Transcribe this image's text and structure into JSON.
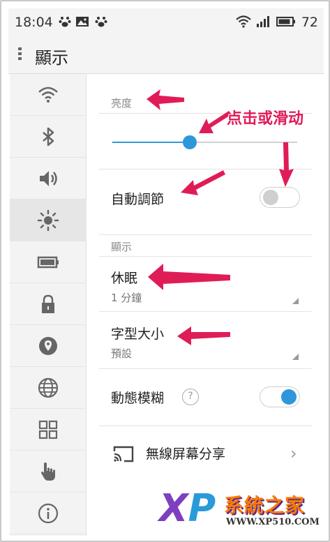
{
  "status_bar": {
    "time": "18:04",
    "battery_level": "72",
    "icons": [
      "paw-icon",
      "image-icon",
      "paw-icon",
      "wifi-icon",
      "signal-icon",
      "battery-icon"
    ]
  },
  "title_bar": {
    "title": "顯示"
  },
  "sidebar": {
    "items": [
      {
        "icon": "wifi-icon"
      },
      {
        "icon": "bluetooth-icon"
      },
      {
        "icon": "volume-icon"
      },
      {
        "icon": "brightness-icon",
        "active": true
      },
      {
        "icon": "battery-icon"
      },
      {
        "icon": "lock-icon"
      },
      {
        "icon": "location-icon"
      },
      {
        "icon": "globe-icon"
      },
      {
        "icon": "apps-grid-icon"
      },
      {
        "icon": "hand-icon"
      },
      {
        "icon": "info-icon"
      }
    ]
  },
  "brightness": {
    "header": "亮度",
    "level": 0.42,
    "auto_label": "自動調節",
    "auto_enabled": false
  },
  "display": {
    "header": "顯示",
    "sleep_label": "休眠",
    "sleep_value": "1 分鐘",
    "font_size_label": "字型大小",
    "font_size_value": "預設",
    "motion_blur_label": "動態模糊",
    "motion_blur_help": "?",
    "motion_blur_enabled": true,
    "cast_label": "無線屏幕分享"
  },
  "annotation": {
    "text": "点击或滑动",
    "color": "#e01c57"
  },
  "watermark": {
    "logo_x": "X",
    "logo_p": "P",
    "brand": "系統之家",
    "url": "WWW.XP510.COM"
  },
  "colors": {
    "accent": "#2f97d9",
    "annotation": "#e01c57"
  }
}
